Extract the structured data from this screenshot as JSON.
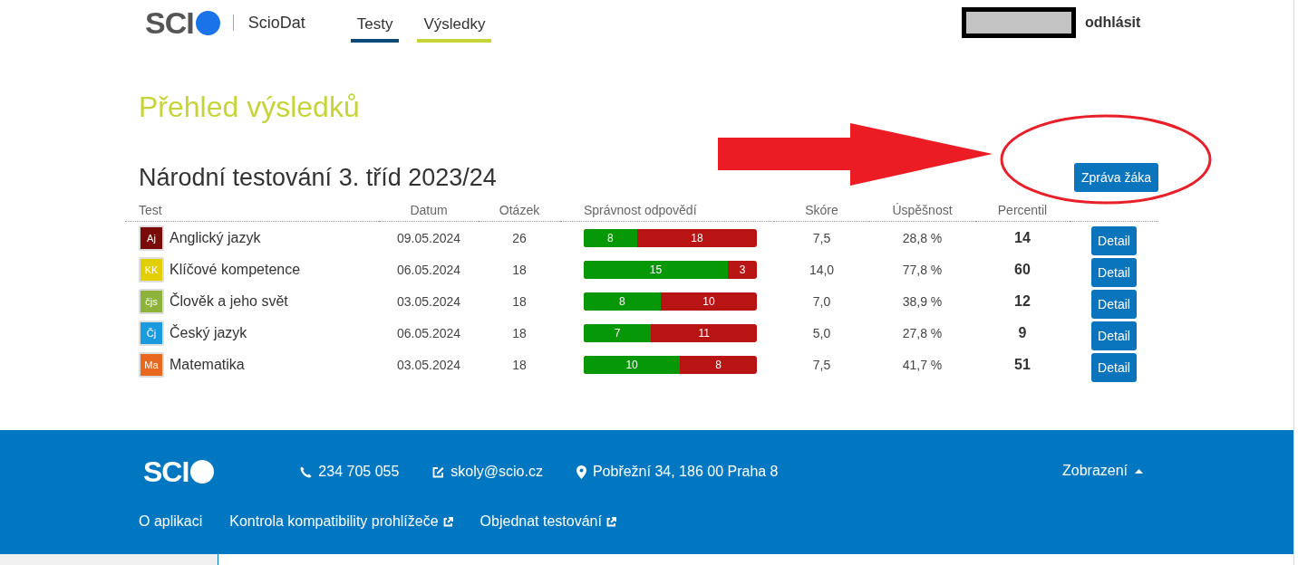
{
  "header": {
    "logo": "SCI",
    "app_name": "ScioDat",
    "tabs": [
      {
        "label": "Testy",
        "color": "#0d4a77"
      },
      {
        "label": "Výsledky",
        "color": "#c6d43a"
      }
    ],
    "logout": "odhlásit"
  },
  "page_title": "Přehled výsledků",
  "section": {
    "title": "Národní testování 3. tříd 2023/24",
    "report_button": "Zpráva žáka",
    "table": {
      "columns": [
        "Test",
        "Datum",
        "Otázek",
        "Správnost odpovědí",
        "Skóre",
        "Úspěšnost",
        "Percentil"
      ],
      "rows": [
        {
          "badge": "Aj",
          "color": "#7a0a0a",
          "test": "Anglický jazyk",
          "date": "09.05.2024",
          "questions": "26",
          "correct": "8",
          "wrong": "18",
          "level": 0.308,
          "score": "7,5",
          "success": "28,8 %",
          "percentile": "14",
          "button": "Detail"
        },
        {
          "badge": "KK",
          "color": "#e2cf00",
          "test": "Klíčové kompetence",
          "date": "06.05.2024",
          "questions": "18",
          "correct": "15",
          "wrong": "3",
          "level": 0.833,
          "score": "14,0",
          "success": "77,8 %",
          "percentile": "60",
          "button": "Detail"
        },
        {
          "badge": "čjs",
          "color": "#8db33a",
          "test": "Člověk a jeho svět",
          "date": "03.05.2024",
          "questions": "18",
          "correct": "8",
          "wrong": "10",
          "level": 0.444,
          "score": "7,0",
          "success": "38,9 %",
          "percentile": "12",
          "button": "Detail"
        },
        {
          "badge": "Čj",
          "color": "#1a9be0",
          "test": "Český jazyk",
          "date": "06.05.2024",
          "questions": "18",
          "correct": "7",
          "wrong": "11",
          "level": 0.389,
          "score": "5,0",
          "success": "27,8 %",
          "percentile": "9",
          "button": "Detail"
        },
        {
          "badge": "Ma",
          "color": "#e8681f",
          "test": "Matematika",
          "date": "03.05.2024",
          "questions": "18",
          "correct": "10",
          "wrong": "8",
          "level": 0.556,
          "score": "7,5",
          "success": "41,7 %",
          "percentile": "51",
          "button": "Detail"
        }
      ]
    }
  },
  "footer": {
    "logo": "SCI",
    "phone": "234 705 055",
    "email": "skoly@scio.cz",
    "address": "Pobřežní 34, 186 00 Praha 8",
    "display_menu": "Zobrazení",
    "links": [
      {
        "label": "O aplikaci",
        "external": false
      },
      {
        "label": "Kontrola kompatibility prohlížeče",
        "external": true
      },
      {
        "label": "Objednat testování",
        "external": true
      }
    ]
  }
}
